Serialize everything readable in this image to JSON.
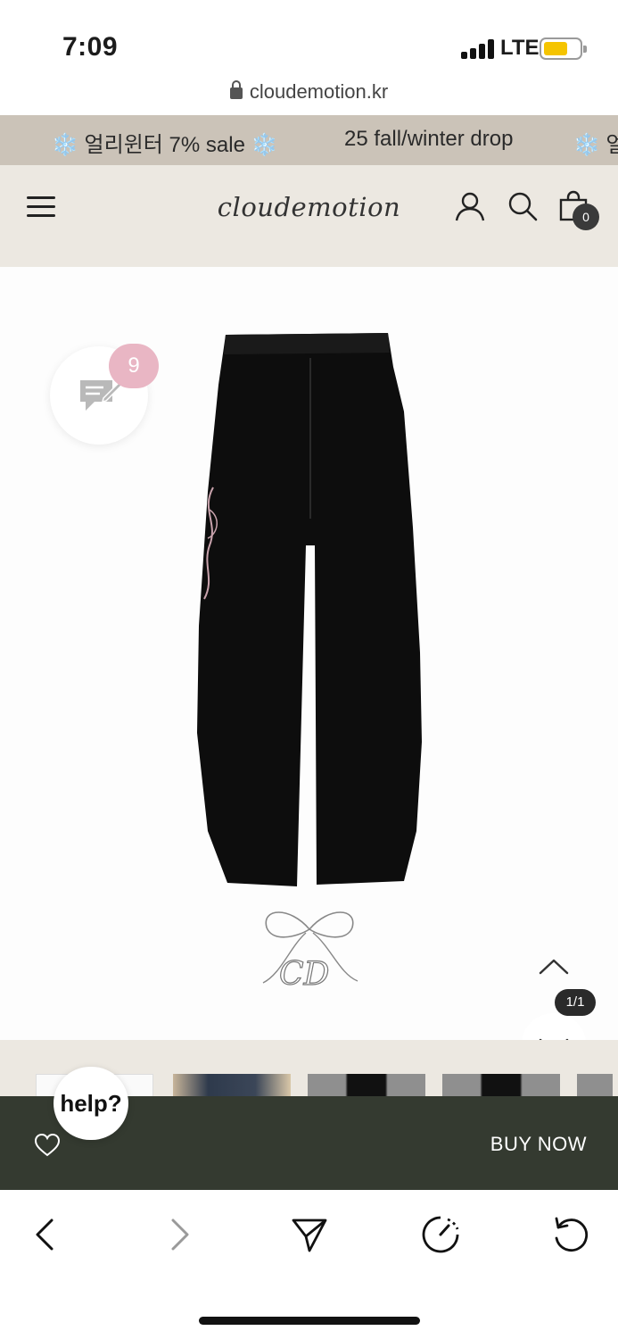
{
  "status_bar": {
    "time": "7:09",
    "network": "LTE",
    "battery_color": "#f5c400"
  },
  "url_bar": {
    "domain": "cloudemotion.kr"
  },
  "announcement": {
    "messages": [
      "❄️ 얼리윈터 7% sale ❄️",
      "25 fall/winter drop",
      "❄️ 얼"
    ]
  },
  "header": {
    "logo": "cloudemotion",
    "cart_count": "0"
  },
  "product": {
    "review_count": "9",
    "image_counter": "1/1",
    "icons": [
      "review-icon",
      "chevron-up-icon",
      "chevron-down-icon"
    ]
  },
  "help": {
    "label": "help?"
  },
  "buy_bar": {
    "buy_now_label": "BUY NOW",
    "icon": "heart-icon"
  },
  "toolbar": {
    "icons": [
      "back-icon",
      "forward-icon",
      "share-icon",
      "speed-icon",
      "refresh-icon"
    ]
  },
  "colors": {
    "announce_bg": "#cbc3b8",
    "header_bg": "#ece8e1",
    "buy_bar_bg": "#343a30",
    "review_badge": "#e9b6c4"
  }
}
